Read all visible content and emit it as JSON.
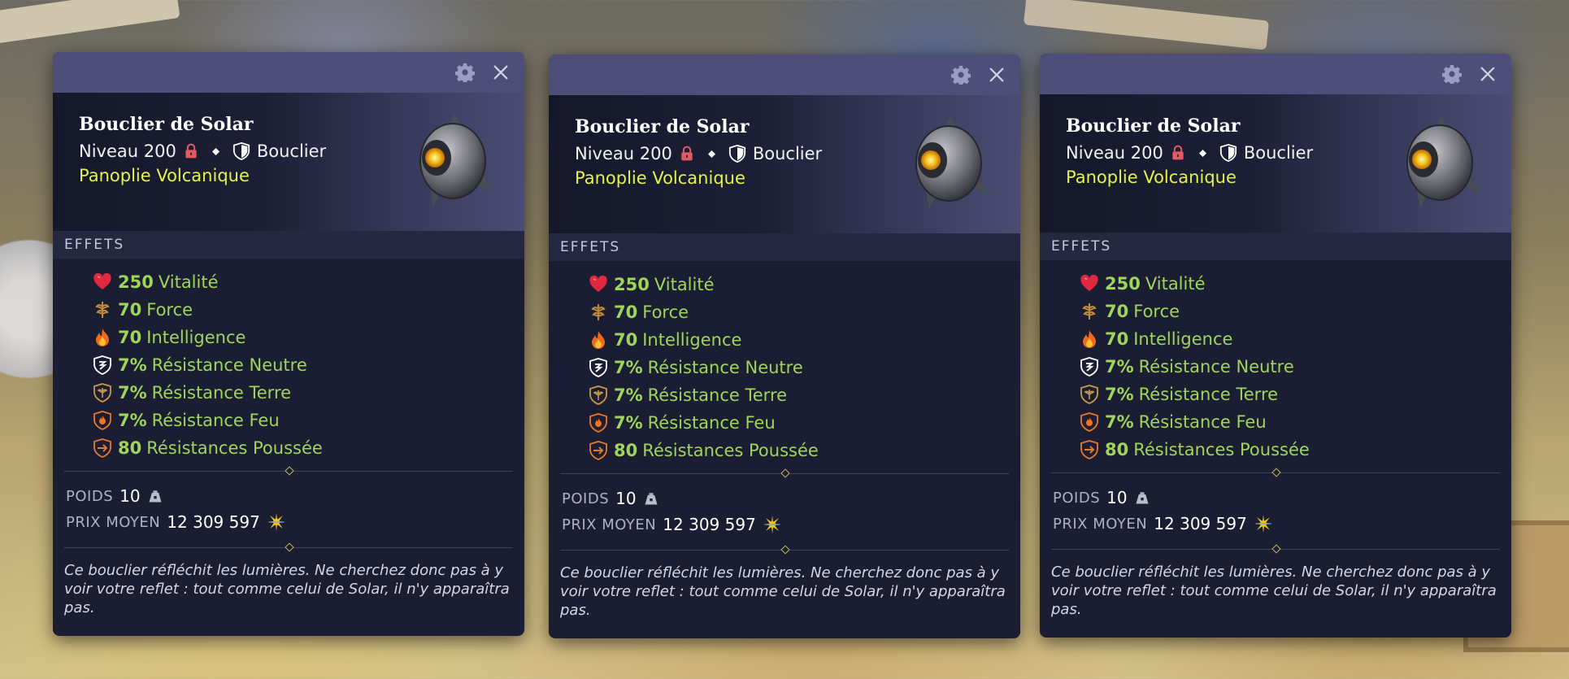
{
  "tooltips": [
    {
      "name": "Bouclier de Solar",
      "level_label": "Niveau 200",
      "type_label": "Bouclier",
      "set_name": "Panoplie Volcanique",
      "section_effects": "EFFETS",
      "effects": [
        {
          "icon": "heart-icon",
          "value": "250",
          "label": "Vitalité"
        },
        {
          "icon": "force-icon",
          "value": "70",
          "label": "Force"
        },
        {
          "icon": "fire-icon",
          "value": "70",
          "label": "Intelligence"
        },
        {
          "icon": "neutral-shield-icon",
          "value": "7%",
          "label": "Résistance Neutre"
        },
        {
          "icon": "earth-shield-icon",
          "value": "7%",
          "label": "Résistance Terre"
        },
        {
          "icon": "fire-shield-icon",
          "value": "7%",
          "label": "Résistance Feu"
        },
        {
          "icon": "push-shield-icon",
          "value": "80",
          "label": "Résistances Poussée"
        }
      ],
      "weight_label": "POIDS",
      "weight_value": "10",
      "price_label": "PRIX MOYEN",
      "price_value": "12 309 597",
      "description": "Ce bouclier réfléchit les lumières. Ne cherchez donc pas à y voir votre reflet : tout comme celui de Solar, il n'y apparaîtra pas."
    },
    {
      "name": "Bouclier de Solar",
      "level_label": "Niveau 200",
      "type_label": "Bouclier",
      "set_name": "Panoplie Volcanique",
      "section_effects": "EFFETS",
      "effects": [
        {
          "icon": "heart-icon",
          "value": "250",
          "label": "Vitalité"
        },
        {
          "icon": "force-icon",
          "value": "70",
          "label": "Force"
        },
        {
          "icon": "fire-icon",
          "value": "70",
          "label": "Intelligence"
        },
        {
          "icon": "neutral-shield-icon",
          "value": "7%",
          "label": "Résistance Neutre"
        },
        {
          "icon": "earth-shield-icon",
          "value": "7%",
          "label": "Résistance Terre"
        },
        {
          "icon": "fire-shield-icon",
          "value": "7%",
          "label": "Résistance Feu"
        },
        {
          "icon": "push-shield-icon",
          "value": "80",
          "label": "Résistances Poussée"
        }
      ],
      "weight_label": "POIDS",
      "weight_value": "10",
      "price_label": "PRIX MOYEN",
      "price_value": "12 309 597",
      "description": "Ce bouclier réfléchit les lumières. Ne cherchez donc pas à y voir votre reflet : tout comme celui de Solar, il n'y apparaîtra pas."
    },
    {
      "name": "Bouclier de Solar",
      "level_label": "Niveau 200",
      "type_label": "Bouclier",
      "set_name": "Panoplie Volcanique",
      "section_effects": "EFFETS",
      "effects": [
        {
          "icon": "heart-icon",
          "value": "250",
          "label": "Vitalité"
        },
        {
          "icon": "force-icon",
          "value": "70",
          "label": "Force"
        },
        {
          "icon": "fire-icon",
          "value": "70",
          "label": "Intelligence"
        },
        {
          "icon": "neutral-shield-icon",
          "value": "7%",
          "label": "Résistance Neutre"
        },
        {
          "icon": "earth-shield-icon",
          "value": "7%",
          "label": "Résistance Terre"
        },
        {
          "icon": "fire-shield-icon",
          "value": "7%",
          "label": "Résistance Feu"
        },
        {
          "icon": "push-shield-icon",
          "value": "80",
          "label": "Résistances Poussée"
        }
      ],
      "weight_label": "POIDS",
      "weight_value": "10",
      "price_label": "PRIX MOYEN",
      "price_value": "12 309 597",
      "description": "Ce bouclier réfléchit les lumières. Ne cherchez donc pas à y voir votre reflet : tout comme celui de Solar, il n'y apparaîtra pas."
    }
  ],
  "colors": {
    "effect_green": "#9fd65a",
    "set_yellow": "#e4f24f",
    "panel_bg": "#1b1d33",
    "titlebar_bg": "#4d4f78"
  }
}
